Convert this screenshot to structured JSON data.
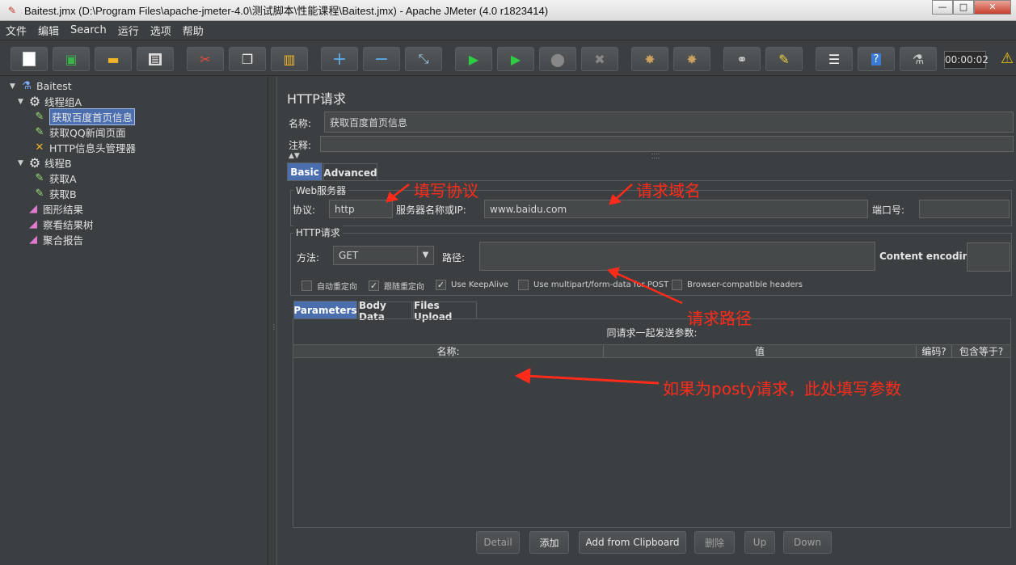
{
  "window": {
    "title": "Baitest.jmx (D:\\Program Files\\apache-jmeter-4.0\\测试脚本\\性能课程\\Baitest.jmx) - Apache JMeter (4.0 r1823414)",
    "minimize": "—",
    "maximize": "□",
    "close": "✕"
  },
  "menu": [
    "文件",
    "编辑",
    "Search",
    "运行",
    "选项",
    "帮助"
  ],
  "toolbar": {
    "timer": "00:00:02",
    "icons": [
      "new-icon",
      "templates-icon",
      "open-icon",
      "save-icon",
      "cut-icon",
      "copy-icon",
      "paste-icon",
      "expand-icon",
      "collapse-icon",
      "toggle-icon",
      "start-icon",
      "start-no-pause-icon",
      "stop-icon",
      "shutdown-icon",
      "clear-icon",
      "clear-all-icon",
      "search-icon",
      "reset-search-icon",
      "function-helper-icon",
      "help-icon",
      "remote-icon"
    ]
  },
  "tree": [
    {
      "label": "Baitest",
      "icon": "flask-icon",
      "toggle": "▼"
    },
    {
      "label": "线程组A",
      "icon": "gear-icon",
      "toggle": "▼"
    },
    {
      "label": "获取百度首页信息",
      "icon": "pipette-icon"
    },
    {
      "label": "获取QQ新闻页面",
      "icon": "pipette-icon"
    },
    {
      "label": "HTTP信息头管理器",
      "icon": "wrench-icon"
    },
    {
      "label": "线程B",
      "icon": "gear-icon",
      "toggle": "▼"
    },
    {
      "label": "获取A",
      "icon": "pipette-icon"
    },
    {
      "label": "获取B",
      "icon": "pipette-icon"
    },
    {
      "label": "图形结果",
      "icon": "chart-icon"
    },
    {
      "label": "察看结果树",
      "icon": "chart-icon"
    },
    {
      "label": "聚合报告",
      "icon": "chart-icon"
    }
  ],
  "panel": {
    "title": "HTTP请求",
    "name_label": "名称:",
    "name_value": "获取百度首页信息",
    "comment_label": "注释:",
    "comment_value": "",
    "tabs": [
      "Basic",
      "Advanced"
    ],
    "web_server": {
      "title": "Web服务器",
      "protocol_label": "协议:",
      "protocol_value": "http",
      "server_label": "服务器名称或IP:",
      "server_value": "www.baidu.com",
      "port_label": "端口号:",
      "port_value": ""
    },
    "http_request": {
      "title": "HTTP请求",
      "method_label": "方法:",
      "method_value": "GET",
      "path_label": "路径:",
      "path_value": "",
      "encoding_label": "Content encoding:",
      "encoding_value": ""
    },
    "checkboxes": [
      {
        "label": "自动重定向",
        "checked": false
      },
      {
        "label": "跟随重定向",
        "checked": true
      },
      {
        "label": "Use KeepAlive",
        "checked": true
      },
      {
        "label": "Use multipart/form-data for POST",
        "checked": false
      },
      {
        "label": "Browser-compatible headers",
        "checked": false
      }
    ],
    "param_tabs": [
      "Parameters",
      "Body Data",
      "Files Upload"
    ],
    "params_caption": "同请求一起发送参数:",
    "columns": [
      "名称:",
      "值",
      "编码?",
      "包含等于?"
    ],
    "buttons": [
      "Detail",
      "添加",
      "Add from Clipboard",
      "删除",
      "Up",
      "Down"
    ]
  },
  "annotations": {
    "protocol": "填写协议",
    "domain": "请求域名",
    "path": "请求路径",
    "post": "如果为posty请求，此处填写参数"
  },
  "colors": {
    "annotation": "#ff2b1a",
    "selection": "#4b6eaf",
    "background": "#3c3f41"
  }
}
